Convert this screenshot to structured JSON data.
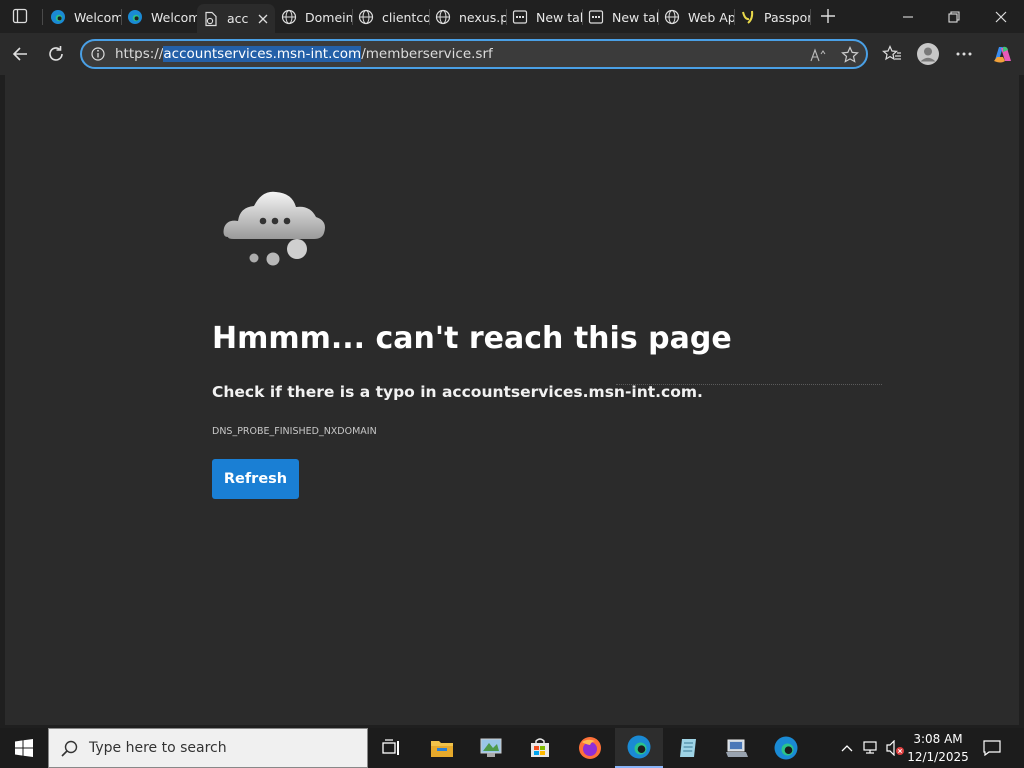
{
  "browser": {
    "tabs": [
      {
        "label": "Welcom",
        "icon": "edge-icon",
        "active": false
      },
      {
        "label": "Welcom",
        "icon": "edge-icon",
        "active": false
      },
      {
        "label": "acc",
        "icon": "document-error-icon",
        "active": true
      },
      {
        "label": "Domein",
        "icon": "globe-icon",
        "active": false
      },
      {
        "label": "clientco",
        "icon": "globe-icon",
        "active": false
      },
      {
        "label": "nexus.p",
        "icon": "globe-icon",
        "active": false
      },
      {
        "label": "New tal",
        "icon": "new-tab-icon",
        "active": false
      },
      {
        "label": "New tal",
        "icon": "new-tab-icon",
        "active": false
      },
      {
        "label": "Web Ap",
        "icon": "globe-icon",
        "active": false
      },
      {
        "label": "Passpor",
        "icon": "passport-icon",
        "active": false
      }
    ],
    "address": {
      "scheme": "https://",
      "host": "accountservices.msn-int.com",
      "path": "/memberservice.srf"
    }
  },
  "page": {
    "title": "Hmmm... can't reach this page",
    "message": "Check if there is a typo in accountservices.msn-int.com.",
    "error_code": "DNS_PROBE_FINISHED_NXDOMAIN",
    "refresh_label": "Refresh"
  },
  "taskbar": {
    "search_placeholder": "Type here to search",
    "apps": [
      "task-view-icon",
      "file-explorer-icon",
      "control-panel-icon",
      "store-icon",
      "firefox-icon",
      "edge-icon",
      "notepad-icon",
      "network-icon",
      "edge-icon"
    ],
    "time": "3:08 AM",
    "date": "12/1/2025"
  },
  "colors": {
    "accent": "#1a7fd4",
    "page_bg": "#2b2b2b",
    "frame_bg": "#202020",
    "omnibox_border": "#4aa0e6"
  }
}
